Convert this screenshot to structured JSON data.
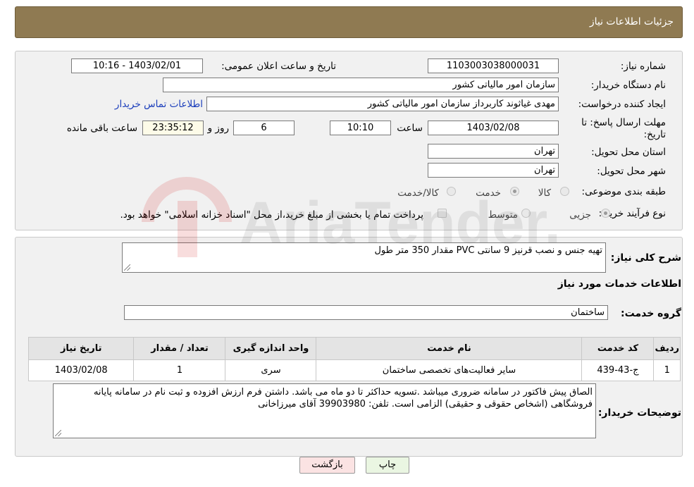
{
  "header": {
    "title": "جزئیات اطلاعات نیاز"
  },
  "fields": {
    "need_number_label": "شماره نیاز:",
    "need_number": "1103003038000031",
    "announce_label": "تاریخ و ساعت اعلان عمومی:",
    "announce_value": "1403/02/01 - 10:16",
    "buyer_org_label": "نام دستگاه خریدار:",
    "buyer_org": "سازمان امور مالیاتی کشور",
    "creator_label": "ایجاد کننده درخواست:",
    "creator": "مهدی غیاثوند کاربرداز سازمان امور مالیاتی کشور",
    "contact_link": "اطلاعات تماس خریدار",
    "deadline_label_1": "مهلت ارسال پاسخ: تا",
    "deadline_label_2": "تاریخ:",
    "deadline_date": "1403/02/08",
    "time_label": "ساعت",
    "deadline_time": "10:10",
    "days_value": "6",
    "days_label": "روز و",
    "remaining_time": "23:35:12",
    "remaining_label": "ساعت باقی مانده",
    "province_label": "استان محل تحویل:",
    "province": "تهران",
    "city_label": "شهر محل تحویل:",
    "city": "تهران",
    "category_label": "طبقه بندی موضوعی:",
    "category_options": [
      "کالا",
      "خدمت",
      "کالا/خدمت"
    ],
    "process_label": "نوع فرآیند خرید :",
    "process_options": [
      "جزیی",
      "متوسط"
    ],
    "payment_note": "پرداخت تمام یا بخشی از مبلغ خرید،از محل \"اسناد خزانه اسلامی\" خواهد بود."
  },
  "summary": {
    "label": "شرح کلی نیاز:",
    "text": "تهیه جنس و نصب قرنیز  9 سانتی  PVC مقدار 350 متر طول"
  },
  "services_title": "اطلاعات خدمات مورد نیاز",
  "service_group": {
    "label": "گروه خدمت:",
    "value": "ساختمان"
  },
  "table": {
    "headers": [
      "ردیف",
      "کد خدمت",
      "نام خدمت",
      "واحد اندازه گیری",
      "تعداد / مقدار",
      "تاریخ نیاز"
    ],
    "rows": [
      [
        "1",
        "ج-43-439",
        "سایر فعالیت‌های تخصصی ساختمان",
        "سری",
        "1",
        "1403/02/08"
      ]
    ]
  },
  "buyer_notes": {
    "label": "توضیحات خریدار:",
    "text": "الصاق پیش فاکتور در سامانه ضروری میباشد .تسویه حداکثر تا دو ماه می باشد.  داشتن فرم ارزش افزوده و ثبت نام در سامانه پایانه فروشگاهی (اشخاص حقوقی و حقیقی) الزامی است. تلفن:  39903980 آقای میرزاخانی"
  },
  "buttons": {
    "print": "چاپ",
    "back": "بازگشت"
  },
  "watermark_text": "AriaTender.net"
}
